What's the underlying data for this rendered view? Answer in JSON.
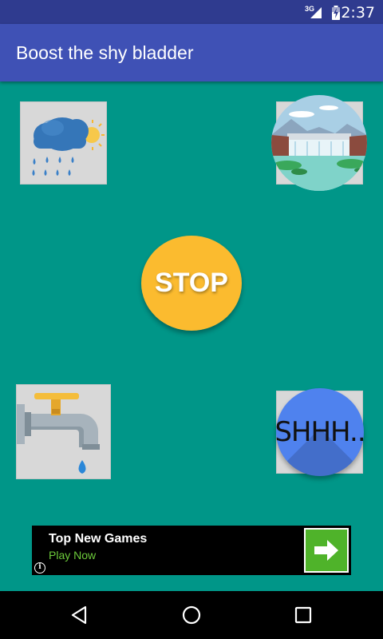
{
  "status_bar": {
    "time": "2:37",
    "network": "3G",
    "icons": [
      "signal-icon",
      "battery-charging-icon"
    ]
  },
  "app_bar": {
    "title": "Boost the shy bladder"
  },
  "tiles": [
    {
      "name": "rain-tile",
      "icon": "rain-cloud-icon"
    },
    {
      "name": "dam-tile",
      "icon": "waterfall-dam-icon"
    },
    {
      "name": "tap-tile",
      "icon": "water-tap-icon"
    },
    {
      "name": "shhh-tile",
      "icon": "shhh-button"
    }
  ],
  "stop_button": {
    "label": "STOP",
    "color": "#fbbb2f"
  },
  "shhh_button": {
    "label": "SHHH..",
    "color": "#4f82ee"
  },
  "ad": {
    "title": "Top New Games",
    "subtitle": "Play Now",
    "info_glyph": "i",
    "icons": [
      "info-icon",
      "arrow-right-icon"
    ]
  },
  "nav_bar": {
    "icons": [
      "back-icon",
      "home-icon",
      "recents-icon"
    ]
  },
  "colors": {
    "background": "#009688",
    "app_bar": "#3f51b5",
    "status_bar": "#2f3b8f"
  }
}
